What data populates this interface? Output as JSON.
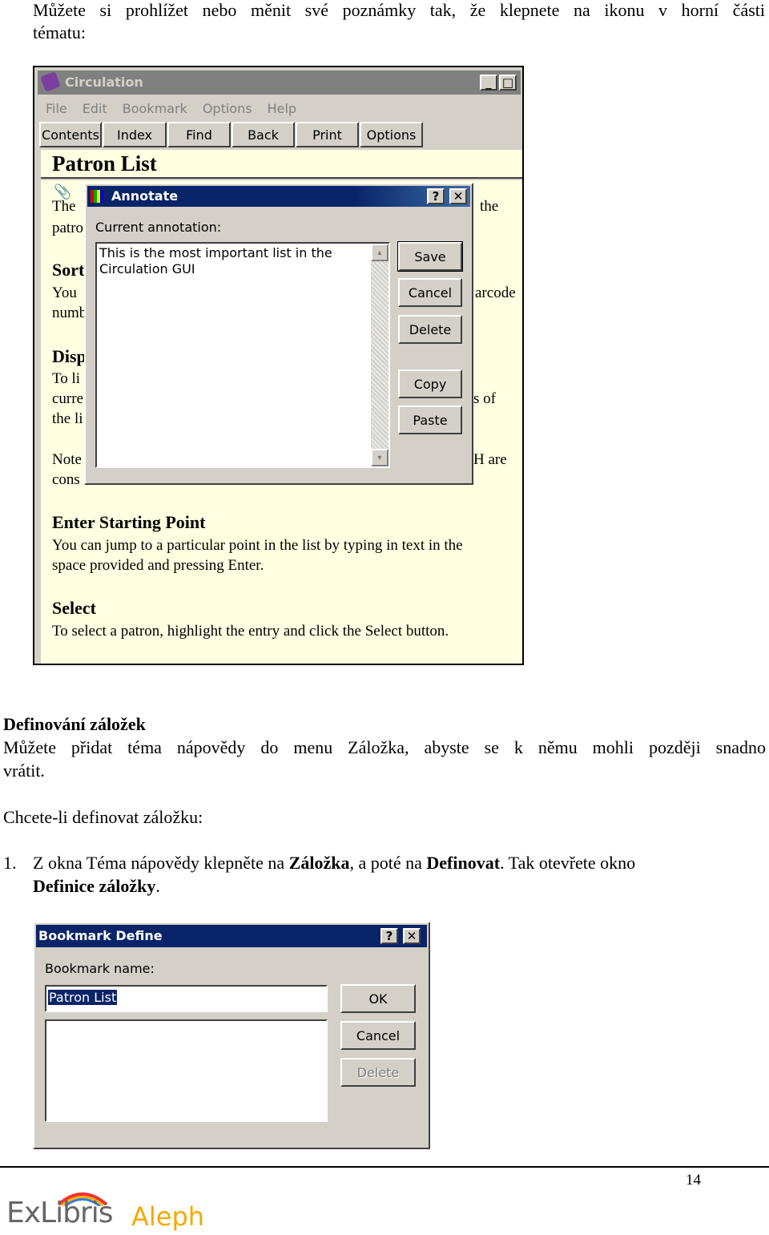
{
  "intro": {
    "line1": "Můžete si prohlížet nebo měnit své poznámky tak, že klepnete na ikonu v horní části",
    "line2": "tématu:"
  },
  "circulation": {
    "title": "Circulation",
    "menu": [
      "File",
      "Edit",
      "Bookmark",
      "Options",
      "Help"
    ],
    "toolbar": [
      "Contents",
      "Index",
      "Find",
      "Back",
      "Print",
      "Options"
    ],
    "heading": "Patron List",
    "behind_left": [
      "The",
      "patro",
      "Sort",
      "You",
      "numb",
      "Disp",
      "To li",
      "curre",
      "the li",
      "Note",
      "cons"
    ],
    "behind_right": [
      "the",
      "arcode",
      "s of",
      "H are"
    ],
    "sections": [
      {
        "heading": "Enter Starting Point",
        "lines": [
          "You can jump to a particular point in the list by typing in text in the",
          "space provided and pressing Enter."
        ]
      },
      {
        "heading": "Select",
        "lines": [
          "To select a patron, highlight the entry and click the Select button."
        ]
      }
    ],
    "colors": {
      "content_bg": "#ffffe1",
      "titlebar_inactive": "#808080",
      "dialog_titlebar": "#0a246a"
    }
  },
  "annotate": {
    "title": "Annotate",
    "label": "Current annotation:",
    "text_line1": "This is the most important list in the",
    "text_line2": "Circulation GUI",
    "buttons": {
      "save": "Save",
      "cancel": "Cancel",
      "delete": "Delete",
      "copy": "Copy",
      "paste": "Paste"
    },
    "help": "?",
    "close": "✕"
  },
  "section": {
    "heading": "Definování záložek",
    "p1_line1": "Můžete přidat téma nápovědy do menu Záložka, abyste se k němu mohli později snadno",
    "p1_line2": "vrátit.",
    "p2": "Chcete-li definovat záložku:",
    "step_num": "1.",
    "step_a": "Z okna Téma nápovědy klepněte na ",
    "step_b": "Záložka",
    "step_c": ", a poté na ",
    "step_d": "Definovat",
    "step_e": ". Tak otevřete okno",
    "step_f": "Definice záložky",
    "step_g": "."
  },
  "bookmark": {
    "title": "Bookmark Define",
    "label": "Bookmark name:",
    "value": "Patron List",
    "buttons": {
      "ok": "OK",
      "cancel": "Cancel",
      "delete": "Delete"
    },
    "help": "?",
    "close": "✕"
  },
  "footer": {
    "page": "14",
    "logo_a": "ExLibris",
    "logo_b": "Aleph"
  }
}
